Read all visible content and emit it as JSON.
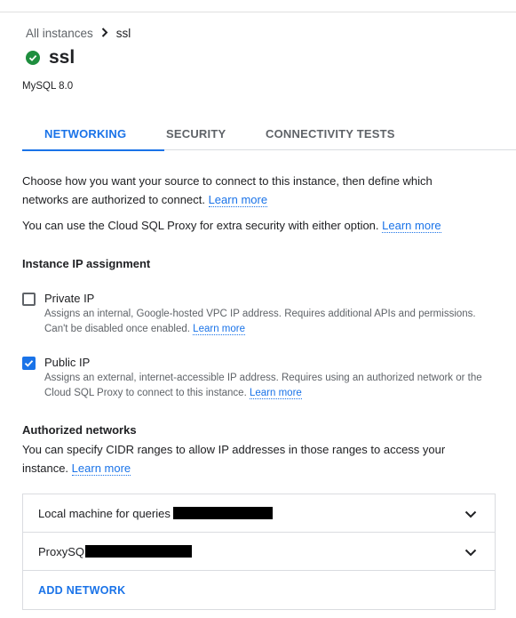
{
  "breadcrumb": {
    "parent": "All instances",
    "current": "ssl"
  },
  "instance": {
    "name": "ssl",
    "db_version": "MySQL 8.0",
    "status_icon": "check-circle-icon",
    "status_color": "#1e8e3e"
  },
  "tabs": [
    {
      "label": "NETWORKING",
      "active": true
    },
    {
      "label": "SECURITY",
      "active": false
    },
    {
      "label": "CONNECTIVITY TESTS",
      "active": false
    }
  ],
  "intro": {
    "text": "Choose how you want your source to connect to this instance, then define which networks are authorized to connect.",
    "link": "Learn more"
  },
  "proxy_note": {
    "text": "You can use the Cloud SQL Proxy for extra security with either option.",
    "link": "Learn more"
  },
  "ip_assignment": {
    "heading": "Instance IP assignment",
    "options": [
      {
        "label": "Private IP",
        "checked": false,
        "description": "Assigns an internal, Google-hosted VPC IP address. Requires additional APIs and permissions. Can't be disabled once enabled.",
        "link": "Learn more"
      },
      {
        "label": "Public IP",
        "checked": true,
        "description": "Assigns an external, internet-accessible IP address. Requires using an authorized network or the Cloud SQL Proxy to connect to this instance.",
        "link": "Learn more"
      }
    ]
  },
  "authorized_networks": {
    "heading": "Authorized networks",
    "text": "You can specify CIDR ranges to allow IP addresses in those ranges to access your instance.",
    "link": "Learn more",
    "items": [
      {
        "name": "Local machine for queries",
        "redacted": true
      },
      {
        "name": "ProxySQ",
        "redacted": true
      }
    ],
    "add_label": "ADD NETWORK"
  },
  "colors": {
    "accent": "#1a73e8",
    "text": "#202124",
    "muted": "#5f6368",
    "divider": "#dadce0"
  }
}
